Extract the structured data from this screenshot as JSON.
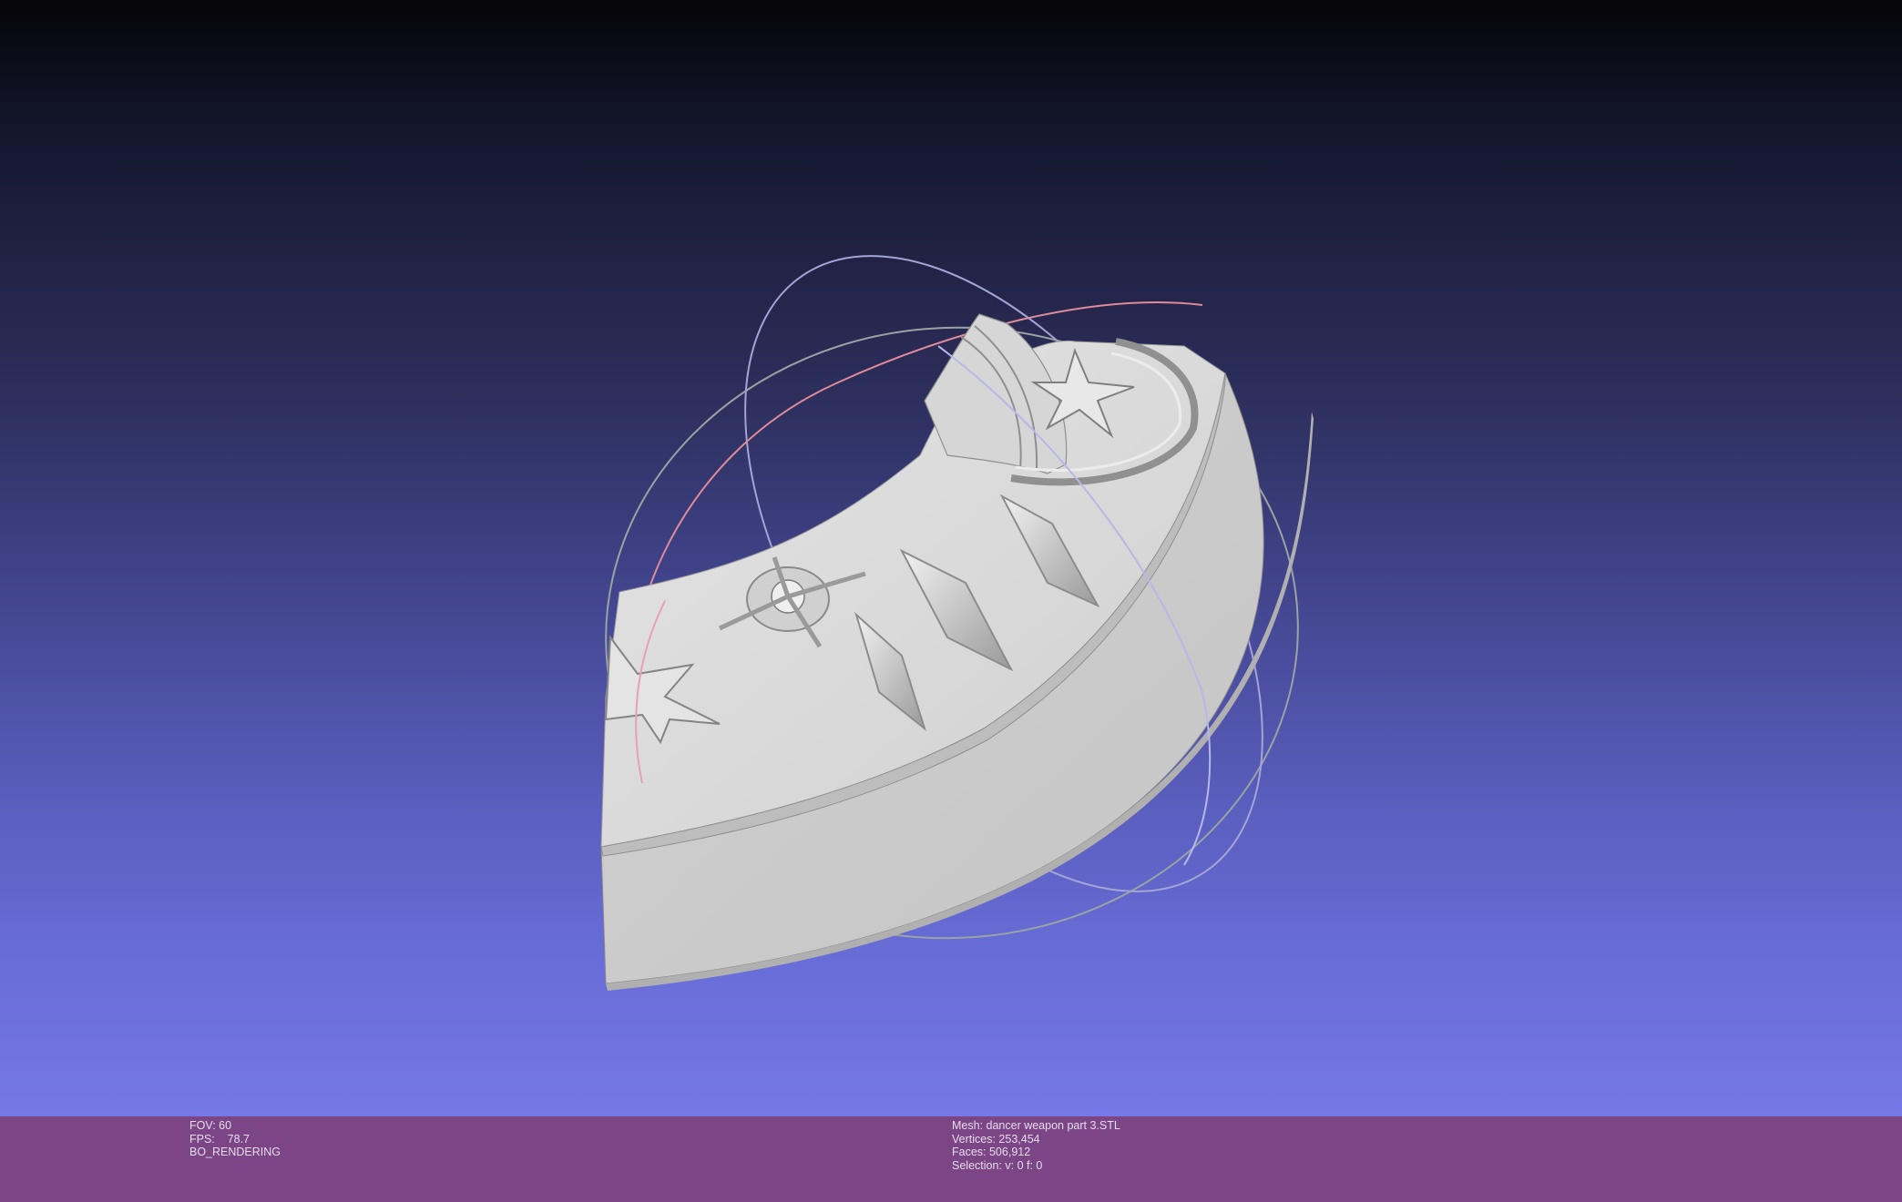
{
  "window": {
    "background_top": "#050508",
    "background_bottom": "#7578e6",
    "statusbar_color": "#7c4586"
  },
  "viewport": {
    "model": "dancer-weapon-ring-segment",
    "trackball": "visible"
  },
  "status_left": {
    "fov": "FOV: 60",
    "fps": "FPS:    78.7",
    "mode": "BO_RENDERING"
  },
  "status_right": {
    "mesh": "Mesh: dancer weapon part 3.STL",
    "vertices": "Vertices: 253,454",
    "faces": "Faces: 506,912",
    "selection": "Selection: v: 0 f: 0"
  }
}
